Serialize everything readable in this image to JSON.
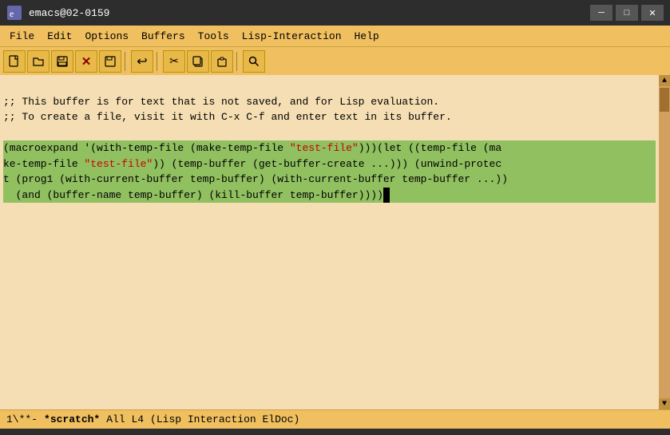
{
  "titlebar": {
    "title": "emacs@02-0159",
    "minimize_label": "─",
    "maximize_label": "□",
    "close_label": "✕",
    "icon": "E"
  },
  "menubar": {
    "items": [
      "File",
      "Edit",
      "Options",
      "Buffers",
      "Tools",
      "Lisp-Interaction",
      "Help"
    ]
  },
  "toolbar": {
    "buttons": [
      {
        "label": "📄",
        "name": "new-file"
      },
      {
        "label": "📂",
        "name": "open-file"
      },
      {
        "label": "💾",
        "name": "save"
      },
      {
        "label": "✕",
        "name": "close"
      },
      {
        "label": "💾",
        "name": "save-alt"
      },
      {
        "label": "↩",
        "name": "undo"
      },
      {
        "label": "✂",
        "name": "cut"
      },
      {
        "label": "📋",
        "name": "copy"
      },
      {
        "label": "📌",
        "name": "paste"
      },
      {
        "label": "🔍",
        "name": "find"
      }
    ]
  },
  "editor": {
    "comment1": ";; This buffer is for text that is not saved, and for Lisp evaluation.",
    "comment2": ";; To create a file, visit it with C-x C-f and enter text in its buffer.",
    "line_blank": "",
    "code_line1": "(macroexpand '(with-temp-file (make-temp-file \"test-file\")))(let ((temp-file (ma",
    "code_line2": "ke-temp-file \"test-file\")) (temp-buffer (get-buffer-create ...))) (unwind-protec",
    "code_line3": "t (prog1 (with-current-buffer temp-buffer) (with-current-buffer temp-buffer ...))",
    "code_line4": "  (and (buffer-name temp-buffer) (kill-buffer temp-buffer))))"
  },
  "statusbar": {
    "mode_indicator": "1\\**-",
    "buffer_name": "*scratch*",
    "position": "All L4",
    "mode": "(Lisp Interaction ElDoc)"
  }
}
